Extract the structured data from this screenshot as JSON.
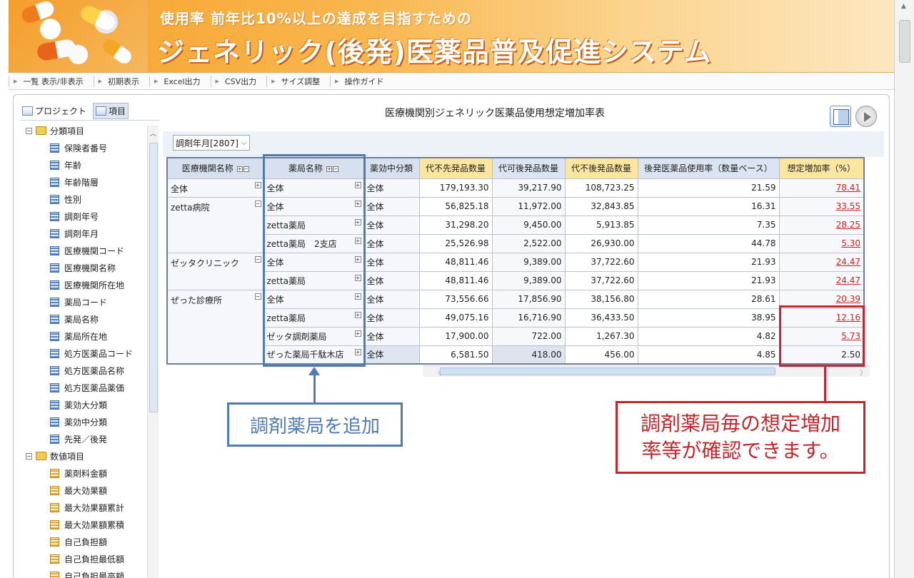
{
  "banner": {
    "subtitle": "使用率 前年比10%以上の達成を目指すための",
    "title": "ジェネリック(後発)医薬品普及促進システム"
  },
  "toolbar": {
    "items": [
      "一覧 表示/非表示",
      "初期表示",
      "Excel出力",
      "CSV出力",
      "サイズ調整",
      "操作ガイド"
    ]
  },
  "left": {
    "tabs": [
      "プロジェクト",
      "項目"
    ],
    "group1": "分類項目",
    "group1_items": [
      "保険者番号",
      "年齢",
      "年齢階層",
      "性別",
      "調剤年号",
      "調剤年月",
      "医療機関コード",
      "医療機関名称",
      "医療機関所在地",
      "薬局コード",
      "薬局名称",
      "薬局所在地",
      "処方医薬品コード",
      "処方医薬品名称",
      "処方医薬品薬価",
      "薬効大分類",
      "薬効中分類",
      "先発／後発"
    ],
    "group2": "数値項目",
    "group2_items": [
      "薬剤料金額",
      "最大効果額",
      "最大効果額累計",
      "最大効果額累積",
      "自己負担額",
      "自己負担最低額",
      "自己負担最高額"
    ]
  },
  "main": {
    "title": "医療機関別ジェネリック医薬品使用想定増加率表",
    "filter": "調剤年月[2807]"
  },
  "table": {
    "headers": [
      "医療機関名称",
      "薬局名称",
      "薬効中分類",
      "代不先発品数量",
      "代可後発品数量",
      "代不後発品数量",
      "後発医薬品使用率（数量ベース）",
      "想定増加率（%）"
    ],
    "clinics": [
      "全体",
      "zetta病院",
      "ゼッタクリニック",
      "ぜった診療所"
    ],
    "rows": [
      {
        "pharmacy": "全体",
        "cat": "全体",
        "v1": "179,193.30",
        "v2": "39,217.90",
        "v3": "108,723.25",
        "v4": "21.59",
        "v5": "78.41"
      },
      {
        "pharmacy": "全体",
        "cat": "全体",
        "v1": "56,825.18",
        "v2": "11,972.00",
        "v3": "32,843.85",
        "v4": "16.31",
        "v5": "33.55"
      },
      {
        "pharmacy": "zetta薬局",
        "cat": "全体",
        "v1": "31,298.20",
        "v2": "9,450.00",
        "v3": "5,913.85",
        "v4": "7.35",
        "v5": "28.25"
      },
      {
        "pharmacy": "zetta薬局　2支店",
        "cat": "全体",
        "v1": "25,526.98",
        "v2": "2,522.00",
        "v3": "26,930.00",
        "v4": "44.78",
        "v5": "5.30"
      },
      {
        "pharmacy": "全体",
        "cat": "全体",
        "v1": "48,811.46",
        "v2": "9,389.00",
        "v3": "37,722.60",
        "v4": "21.93",
        "v5": "24.47"
      },
      {
        "pharmacy": "zetta薬局",
        "cat": "全体",
        "v1": "48,811.46",
        "v2": "9,389.00",
        "v3": "37,722.60",
        "v4": "21.93",
        "v5": "24.47"
      },
      {
        "pharmacy": "全体",
        "cat": "全体",
        "v1": "73,556.66",
        "v2": "17,856.90",
        "v3": "38,156.80",
        "v4": "28.61",
        "v5": "20.39"
      },
      {
        "pharmacy": "zetta薬局",
        "cat": "全体",
        "v1": "49,075.16",
        "v2": "16,716.90",
        "v3": "36,433.50",
        "v4": "38.95",
        "v5": "12.16"
      },
      {
        "pharmacy": "ゼッタ調剤薬局",
        "cat": "全体",
        "v1": "17,900.00",
        "v2": "722.00",
        "v3": "1,267.30",
        "v4": "4.82",
        "v5": "5.73"
      },
      {
        "pharmacy": "ぜった薬局千駄木店",
        "cat": "全体",
        "v1": "6,581.50",
        "v2": "418.00",
        "v3": "456.00",
        "v4": "4.85",
        "v5": "2.50"
      }
    ]
  },
  "annotations": {
    "blue": "調剤薬局を追加",
    "red_line1": "調剤薬局毎の想定増加",
    "red_line2": "率等が確認できます。"
  },
  "colors": {
    "accent_blue": "#4f7bb0",
    "accent_red": "#c1272d",
    "link_red": "#d42020"
  }
}
